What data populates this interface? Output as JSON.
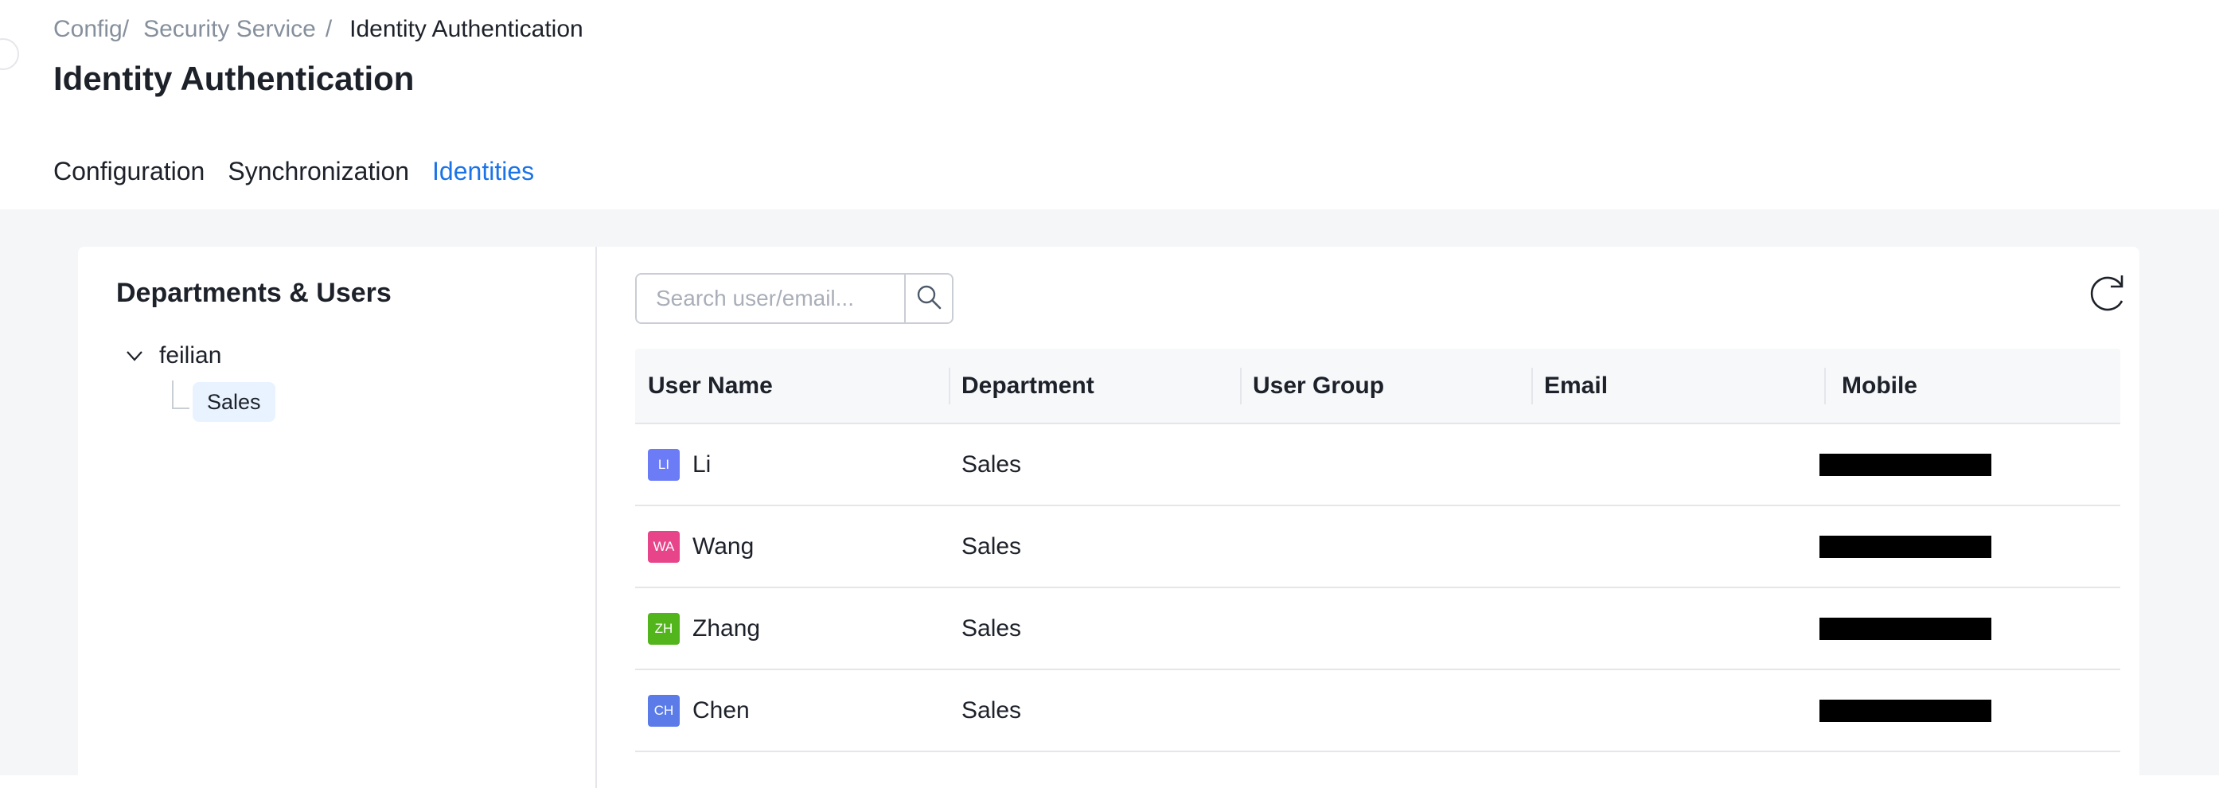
{
  "breadcrumb": {
    "items": [
      "Config",
      "Security Service",
      "Identity Authentication"
    ],
    "separator": "/"
  },
  "page": {
    "title": "Identity Authentication"
  },
  "tabs": [
    {
      "label": "Configuration",
      "active": false
    },
    {
      "label": "Synchronization",
      "active": false
    },
    {
      "label": "Identities",
      "active": true
    }
  ],
  "sidebar": {
    "title": "Departments & Users",
    "tree": {
      "root": {
        "label": "feilian",
        "expanded": true,
        "icon": "chevron-down-icon"
      },
      "children": [
        {
          "label": "Sales",
          "selected": true
        }
      ]
    }
  },
  "search": {
    "placeholder": "Search user/email...",
    "value": "",
    "icon": "search-icon"
  },
  "refresh": {
    "icon": "refresh-icon"
  },
  "table": {
    "columns": [
      "User Name",
      "Department",
      "User Group",
      "Email",
      "Mobile"
    ],
    "rows": [
      {
        "avatar": "LI",
        "avatar_color": "#6b7cf6",
        "name": "Li",
        "department": "Sales",
        "group": "",
        "email": "",
        "mobile_redacted": true
      },
      {
        "avatar": "WA",
        "avatar_color": "#e8448a",
        "name": "Wang",
        "department": "Sales",
        "group": "",
        "email": "",
        "mobile_redacted": true
      },
      {
        "avatar": "ZH",
        "avatar_color": "#52b51c",
        "name": "Zhang",
        "department": "Sales",
        "group": "",
        "email": "",
        "mobile_redacted": true
      },
      {
        "avatar": "CH",
        "avatar_color": "#5b7ce8",
        "name": "Chen",
        "department": "Sales",
        "group": "",
        "email": "",
        "mobile_redacted": true
      }
    ]
  },
  "colors": {
    "accent": "#1a73e8",
    "selected_bg": "#e8f3ff",
    "page_bg": "#f5f6f8"
  }
}
